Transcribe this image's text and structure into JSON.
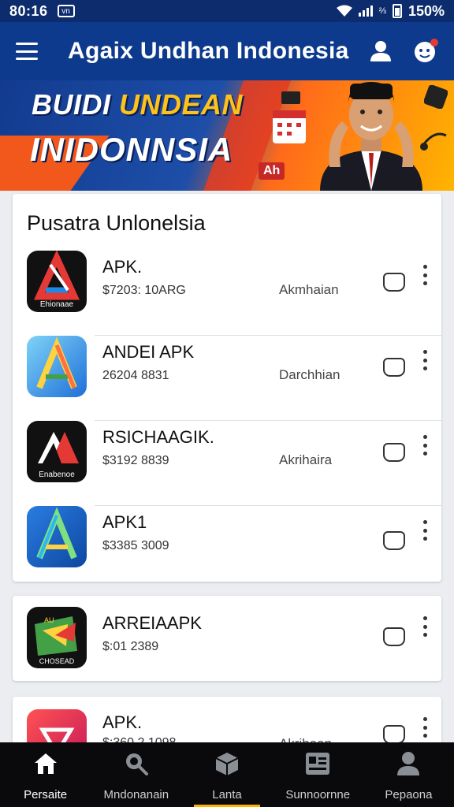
{
  "status_bar": {
    "time": "80:16",
    "notification_icon": "vpn-icon",
    "battery_level": "150%"
  },
  "app_bar": {
    "title": "Agaix Undhan  Indonesia",
    "menu_icon": "hamburger-icon",
    "profile_icon": "user-icon",
    "notification_icon": "smiley-bell-icon"
  },
  "banner": {
    "line1_white": "BUIDI",
    "line1_yellow": "UNDEAN",
    "line2": "INIDONNSIA",
    "badge": "Ah"
  },
  "section": {
    "title": "Pusatra Unlonelsia"
  },
  "apps": [
    {
      "name": "APK.",
      "subtitle": "$7203: 10ARG",
      "status": "Akmhaian",
      "icon_label": "Ehionaae",
      "icon_style": "dark-red-blue"
    },
    {
      "name": "ANDEI APK",
      "subtitle": "26204 8831",
      "status": "Darchhian",
      "icon_label": "",
      "icon_style": "light-blue"
    },
    {
      "name": "RSICHAAGIK.",
      "subtitle": "$3192 8839",
      "status": "Akrihaira",
      "icon_label": "Enabenoe",
      "icon_style": "dark-red"
    },
    {
      "name": "APK1",
      "subtitle": "$3385 3009",
      "status": "",
      "icon_label": "",
      "icon_style": "blue-green"
    }
  ],
  "featured_app": {
    "name": "ARREIAAPK",
    "subtitle": "$:01 2389",
    "icon_label": "CHOSEAD",
    "icon_badge": "AU"
  },
  "partial_app": {
    "name": "APK.",
    "subtitle": "$:360 2 1098",
    "status": "Akrihaan"
  },
  "bottom_nav": [
    {
      "label": "Persaite",
      "icon": "home-icon",
      "active": true
    },
    {
      "label": "Mndonanain",
      "icon": "search-icon",
      "active": false
    },
    {
      "label": "Lanta",
      "icon": "box-icon",
      "active": false
    },
    {
      "label": "Sunnoornne",
      "icon": "news-icon",
      "active": false
    },
    {
      "label": "Pepaona",
      "icon": "person-icon",
      "active": false
    }
  ],
  "colors": {
    "app_bar": "#0d3a8c",
    "status_bar": "#0d2c6e",
    "accent_yellow": "#ffc21a",
    "nav_bg": "#0a0a0c"
  }
}
